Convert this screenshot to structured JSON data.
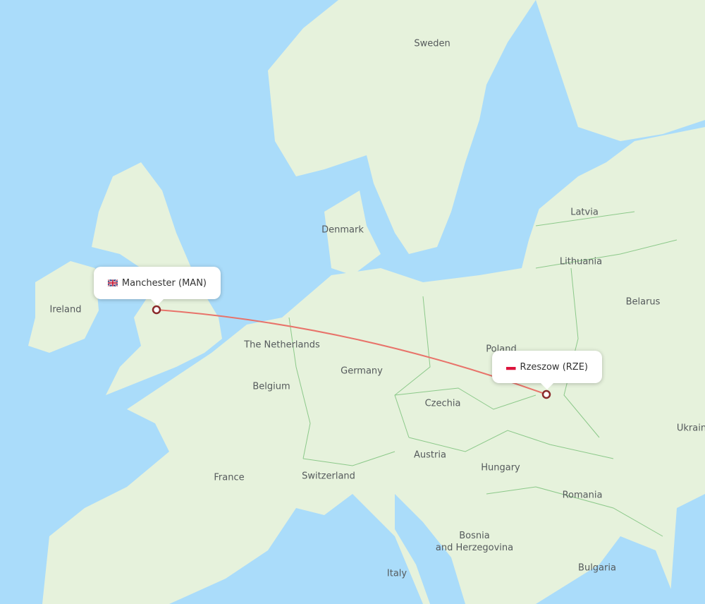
{
  "route": {
    "origin": {
      "city": "Manchester",
      "code": "MAN",
      "label": "Manchester (MAN)",
      "flag": "uk-flag"
    },
    "destination": {
      "city": "Rzeszow",
      "code": "RZE",
      "label": "Rzeszow (RZE)",
      "flag": "poland-flag"
    },
    "line_color": "#e8736a",
    "marker_color": "#8a2a2a"
  },
  "colors": {
    "sea": "#aadcfa",
    "land": "#e6f2dc",
    "border": "#8cc98a",
    "label": "#555a5c"
  },
  "countries": [
    {
      "name": "Sweden"
    },
    {
      "name": "Denmark"
    },
    {
      "name": "Latvia"
    },
    {
      "name": "Lithuania"
    },
    {
      "name": "Ireland"
    },
    {
      "name": "Belarus"
    },
    {
      "name": "The Netherlands"
    },
    {
      "name": "Poland"
    },
    {
      "name": "Germany"
    },
    {
      "name": "Belgium"
    },
    {
      "name": "Czechia"
    },
    {
      "name": "Ukraine"
    },
    {
      "name": "Austria"
    },
    {
      "name": "Hungary"
    },
    {
      "name": "France"
    },
    {
      "name": "Switzerland"
    },
    {
      "name": "Romania"
    },
    {
      "name": "Bosnia\nand Herzegovina"
    },
    {
      "name": "Bulgaria"
    },
    {
      "name": "Italy"
    }
  ]
}
